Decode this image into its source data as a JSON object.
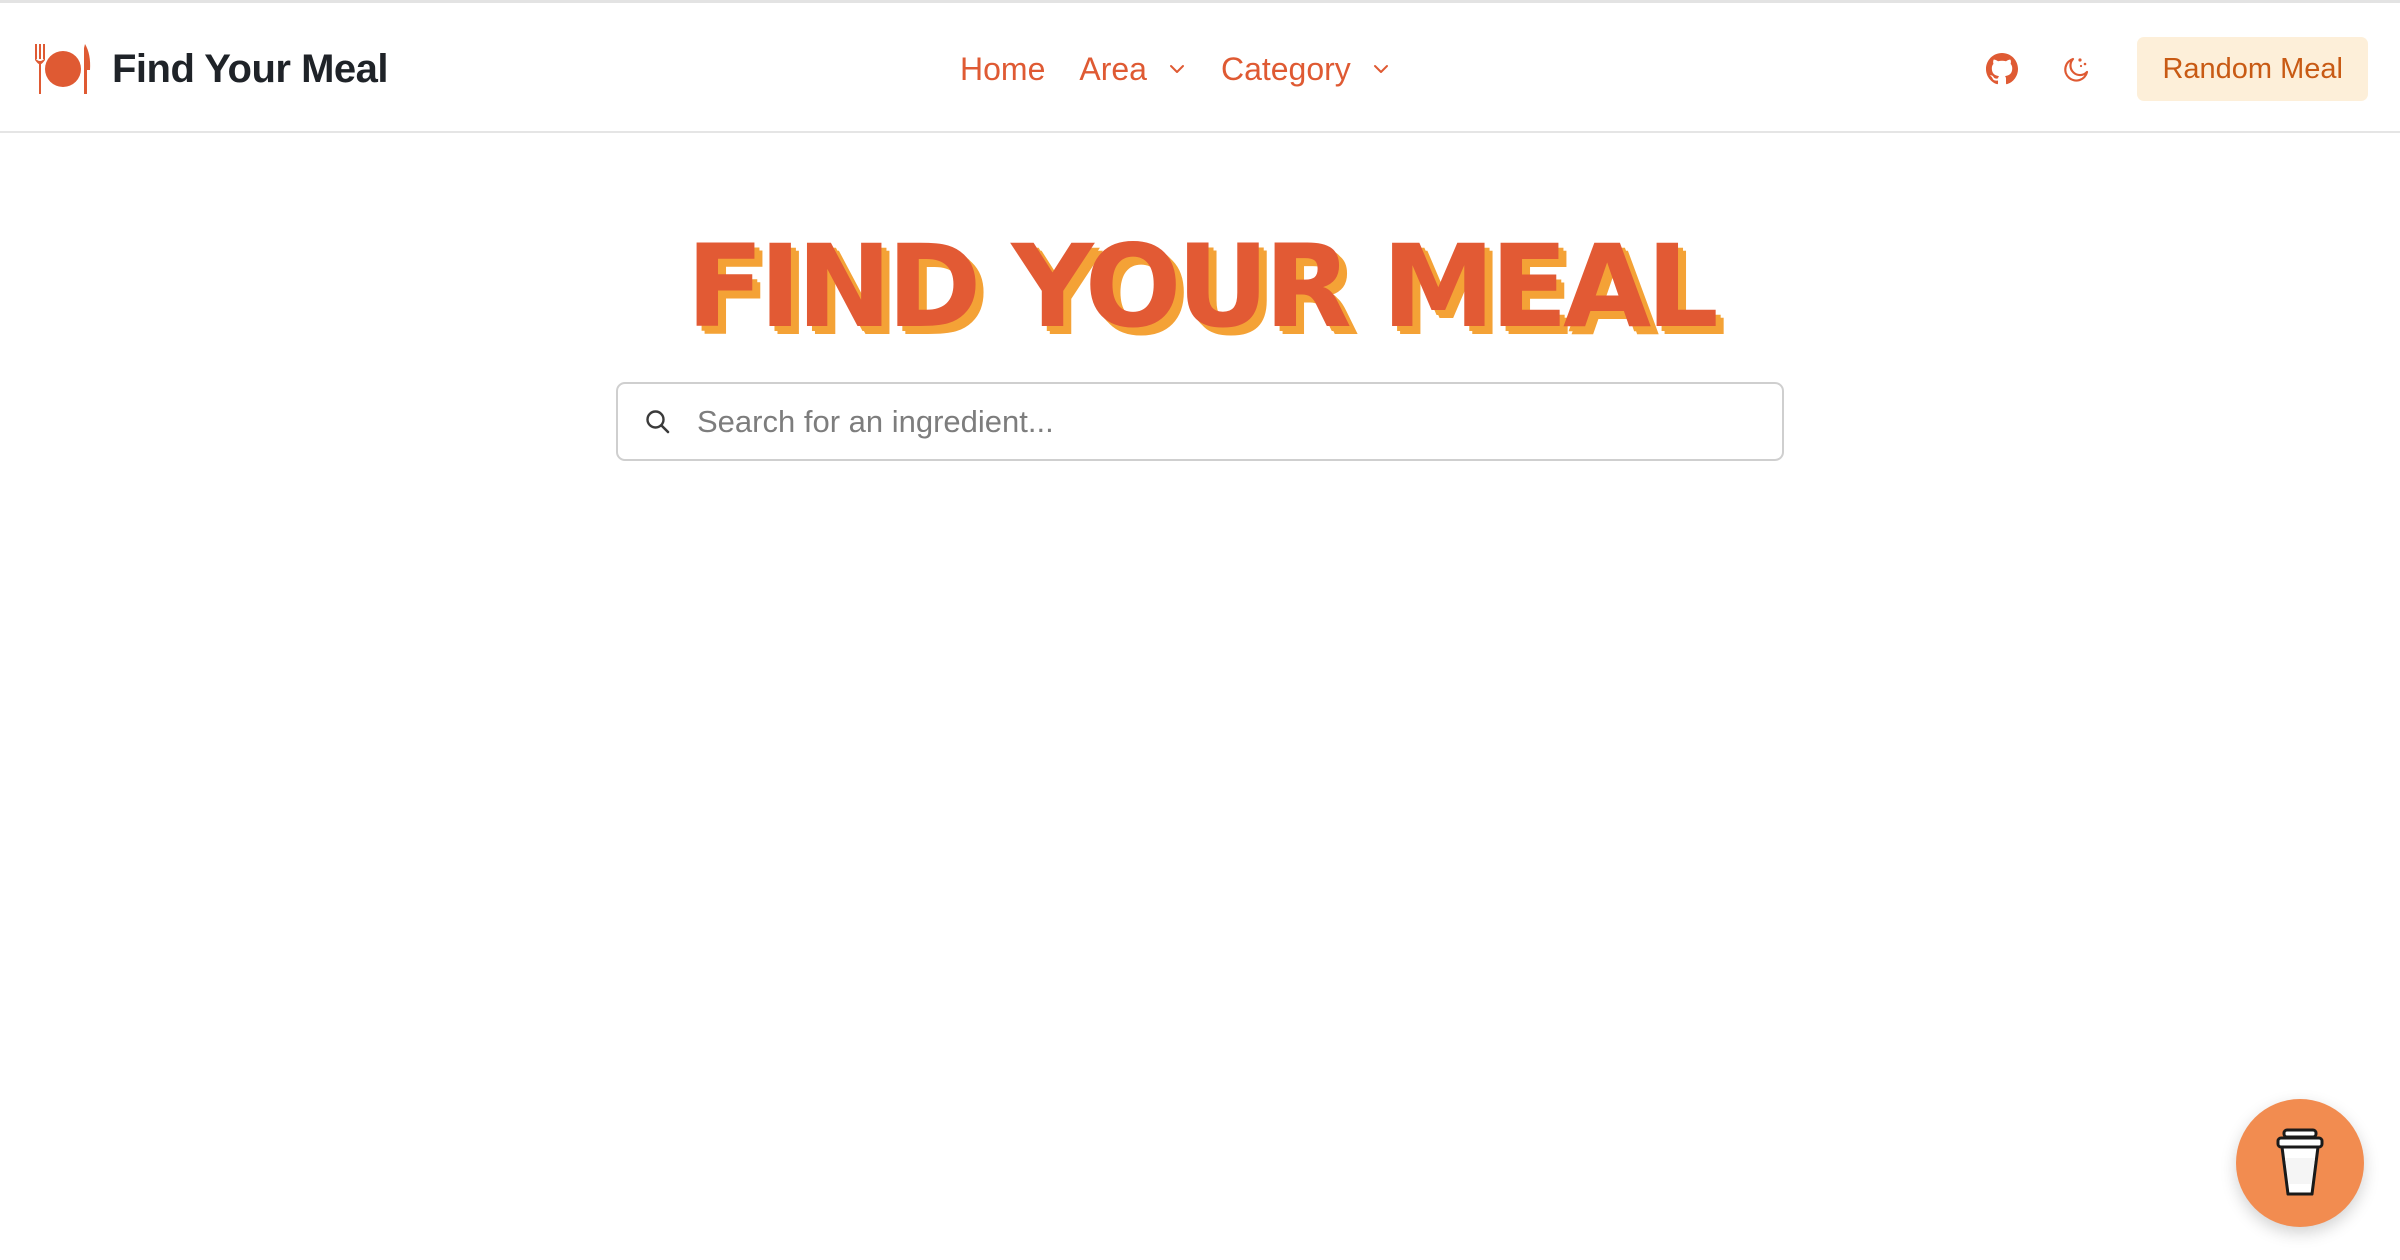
{
  "brand": {
    "title": "Find Your Meal",
    "logo_icon": "plate-cutlery-icon",
    "accent_color": "#df5a33"
  },
  "nav": {
    "home": "Home",
    "area": "Area",
    "category": "Category"
  },
  "header_actions": {
    "github_icon": "github-icon",
    "theme_icon": "theme-toggle-icon",
    "random_meal": "Random Meal"
  },
  "hero": {
    "title": "FIND YOUR MEAL",
    "title_color": "#e25a34",
    "shadow_color": "#f4a236"
  },
  "search": {
    "placeholder": "Search for an ingredient...",
    "value": ""
  },
  "fab": {
    "icon": "coffee-cup-icon",
    "color": "#f28c50"
  }
}
